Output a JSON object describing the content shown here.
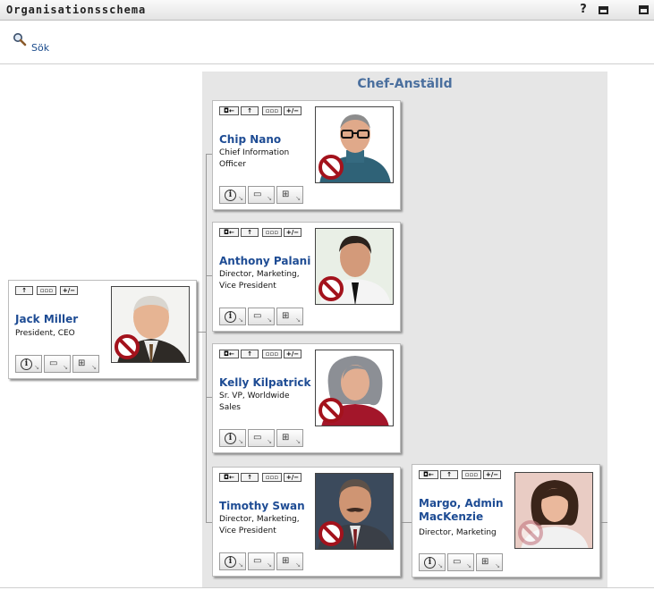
{
  "window": {
    "title": "Organisationsschema"
  },
  "search": {
    "label": "Sök"
  },
  "panel": {
    "title": "Chef-Anställd"
  },
  "toolbar": {
    "plusminus": "+/−"
  },
  "people": {
    "jack": {
      "name": "Jack Miller",
      "title": "President, CEO"
    },
    "chip": {
      "name": "Chip Nano",
      "title": "Chief Information Officer"
    },
    "anthony": {
      "name": "Anthony Palani",
      "title": "Director, Marketing, Vice President"
    },
    "kelly": {
      "name": "Kelly Kilpatrick",
      "title": "Sr. VP, Worldwide Sales"
    },
    "timothy": {
      "name": "Timothy Swan",
      "title": "Director, Marketing, Vice President"
    },
    "margo": {
      "name": "Margo, Admin MacKenzie",
      "title": "Director, Marketing"
    }
  }
}
